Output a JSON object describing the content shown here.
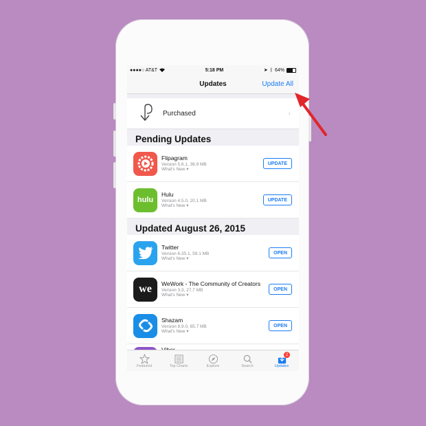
{
  "status": {
    "carrier": "●●●●○ AT&T",
    "time": "5:18 PM",
    "battery": "64%"
  },
  "nav": {
    "title": "Updates",
    "update_all": "Update All"
  },
  "purchased": {
    "label": "Purchased"
  },
  "sections": [
    {
      "title": "Pending Updates",
      "apps": [
        {
          "name": "Flipagram",
          "meta": "Version 5.6.1, 36.9 MB",
          "whats_new": "What's New ▾",
          "button": "UPDATE",
          "icon_color": "#f0584c"
        },
        {
          "name": "Hulu",
          "meta": "Version 4.5.0, 20.1 MB",
          "whats_new": "What's New ▾",
          "button": "UPDATE",
          "icon_text": "hulu",
          "icon_color": "#6dbe2f"
        }
      ]
    },
    {
      "title": "Updated August 26, 2015",
      "apps": [
        {
          "name": "Twitter",
          "meta": "Version 6.35.1, 59.1 MB",
          "whats_new": "What's New ▾",
          "button": "OPEN",
          "icon_color": "#2aa3ef"
        },
        {
          "name": "WeWork - The Community of Creators",
          "meta": "Version 3.3, 27.7 MB",
          "whats_new": "What's New ▾",
          "button": "OPEN",
          "icon_text": "we",
          "icon_color": "#1b1b1b"
        },
        {
          "name": "Shazam",
          "meta": "Version 8.9.0, 65.7 MB",
          "whats_new": "What's New ▾",
          "button": "OPEN",
          "icon_color": "#1a8ee6"
        },
        {
          "name": "Viber",
          "meta": "",
          "whats_new": "",
          "button": "",
          "icon_color": "#8b55c7"
        }
      ]
    }
  ],
  "tabs": [
    {
      "label": "Featured",
      "icon": "star-icon"
    },
    {
      "label": "Top Charts",
      "icon": "list-icon"
    },
    {
      "label": "Explore",
      "icon": "compass-icon"
    },
    {
      "label": "Search",
      "icon": "search-icon"
    },
    {
      "label": "Updates",
      "icon": "download-tray-icon",
      "badge": "2",
      "active": true
    }
  ],
  "colors": {
    "accent": "#1a7cf5",
    "background": "#b98bc1",
    "annotation_arrow": "#e0262a"
  }
}
